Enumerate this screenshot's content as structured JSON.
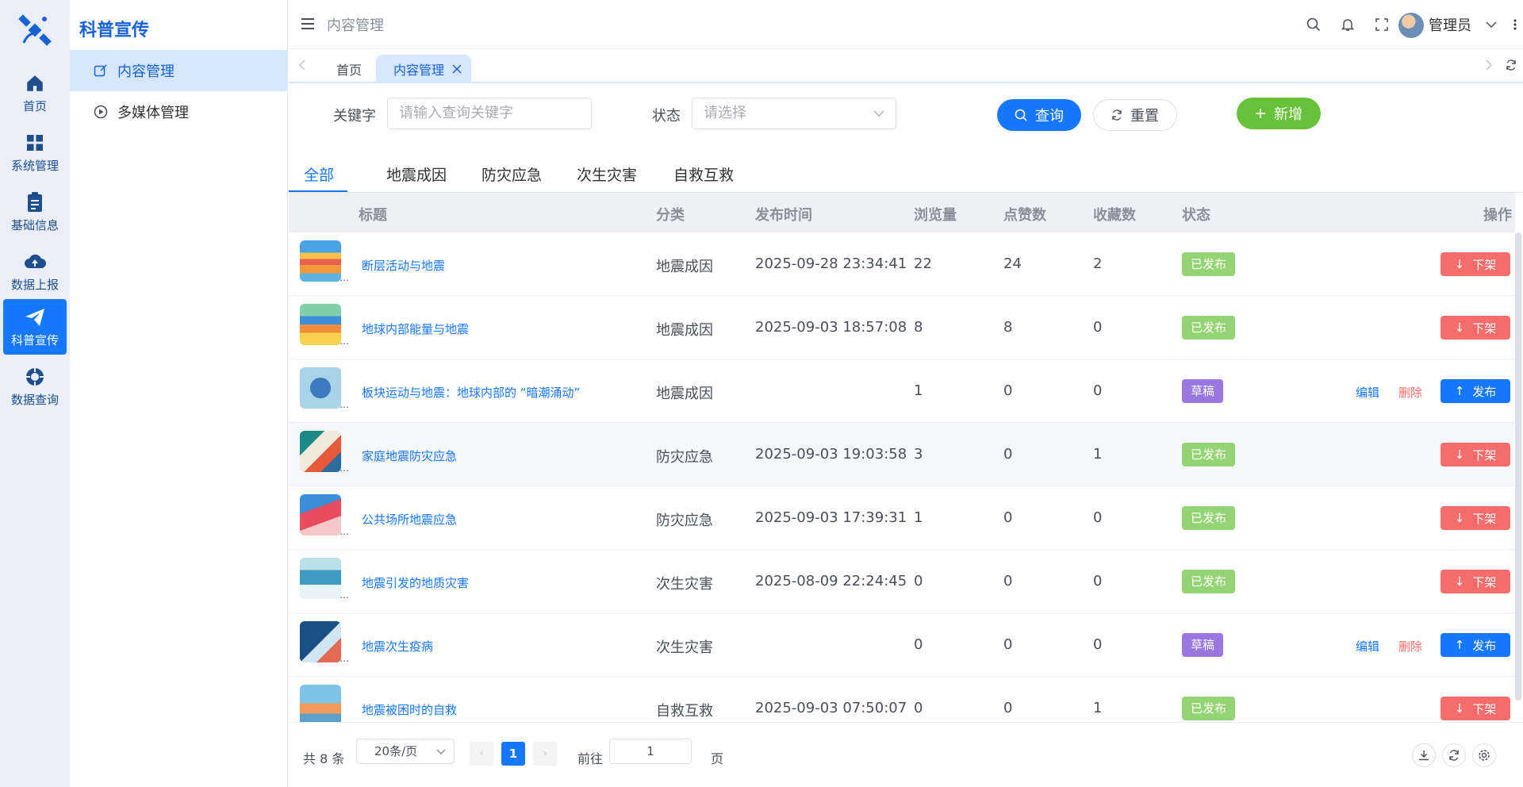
{
  "rail": {
    "items": [
      {
        "label": "首页",
        "icon": "home-icon"
      },
      {
        "label": "系统管理",
        "icon": "grid-icon"
      },
      {
        "label": "基础信息",
        "icon": "clipboard-icon"
      },
      {
        "label": "数据上报",
        "icon": "cloud-upload-icon"
      },
      {
        "label": "科普宣传",
        "icon": "paper-plane-icon",
        "active": true
      },
      {
        "label": "数据查询",
        "icon": "compass-icon"
      }
    ]
  },
  "sidebar": {
    "title": "科普宣传",
    "items": [
      {
        "label": "内容管理",
        "icon": "edit-icon",
        "active": true
      },
      {
        "label": "多媒体管理",
        "icon": "play-circle-icon"
      }
    ]
  },
  "header": {
    "title": "内容管理",
    "user": "管理员"
  },
  "tabs": {
    "home": "首页",
    "active": "内容管理"
  },
  "filters": {
    "keyword_label": "关键字",
    "keyword_placeholder": "请输入查询关键字",
    "status_label": "状态",
    "status_placeholder": "请选择",
    "query": "查询",
    "reset": "重置",
    "add": "新增"
  },
  "categories": [
    "全部",
    "地震成因",
    "防灾应急",
    "次生灾害",
    "自救互救"
  ],
  "table": {
    "columns": [
      "标题",
      "分类",
      "发布时间",
      "浏览量",
      "点赞数",
      "收藏数",
      "状态",
      "操作"
    ],
    "rows": [
      {
        "title": "断层活动与地震",
        "category": "地震成因",
        "time": "2025-09-28 23:34:41",
        "views": "22",
        "likes": "24",
        "favs": "2",
        "status": "已发布",
        "action": "下架"
      },
      {
        "title": "地球内部能量与地震",
        "category": "地震成因",
        "time": "2025-09-03 18:57:08",
        "views": "8",
        "likes": "8",
        "favs": "0",
        "status": "已发布",
        "action": "下架"
      },
      {
        "title": "板块运动与地震：地球内部的 “暗潮涌动”",
        "category": "地震成因",
        "time": "",
        "views": "1",
        "likes": "0",
        "favs": "0",
        "status": "草稿",
        "action": "发布",
        "edit": "编辑",
        "delete": "删除"
      },
      {
        "title": "家庭地震防灾应急",
        "category": "防灾应急",
        "time": "2025-09-03 19:03:58",
        "views": "3",
        "likes": "0",
        "favs": "1",
        "status": "已发布",
        "action": "下架"
      },
      {
        "title": "公共场所地震应急",
        "category": "防灾应急",
        "time": "2025-09-03 17:39:31",
        "views": "1",
        "likes": "0",
        "favs": "0",
        "status": "已发布",
        "action": "下架"
      },
      {
        "title": "地震引发的地质灾害",
        "category": "次生灾害",
        "time": "2025-08-09 22:24:45",
        "views": "0",
        "likes": "0",
        "favs": "0",
        "status": "已发布",
        "action": "下架"
      },
      {
        "title": "地震次生疫病",
        "category": "次生灾害",
        "time": "",
        "views": "0",
        "likes": "0",
        "favs": "0",
        "status": "草稿",
        "action": "发布",
        "edit": "编辑",
        "delete": "删除"
      },
      {
        "title": "地震被困时的自救",
        "category": "自救互救",
        "time": "2025-09-03 07:50:07",
        "views": "0",
        "likes": "0",
        "favs": "1",
        "status": "已发布",
        "action": "下架"
      }
    ]
  },
  "pagination": {
    "total": "共 8 条",
    "page_size": "20条/页",
    "current": "1",
    "goto_label": "前往",
    "goto_value": "1",
    "page_suffix": "页"
  },
  "colors": {
    "primary": "#1677ff",
    "success": "#67c23a",
    "danger": "#f56c6c",
    "draft": "#9a76e0",
    "published": "#95d475"
  }
}
